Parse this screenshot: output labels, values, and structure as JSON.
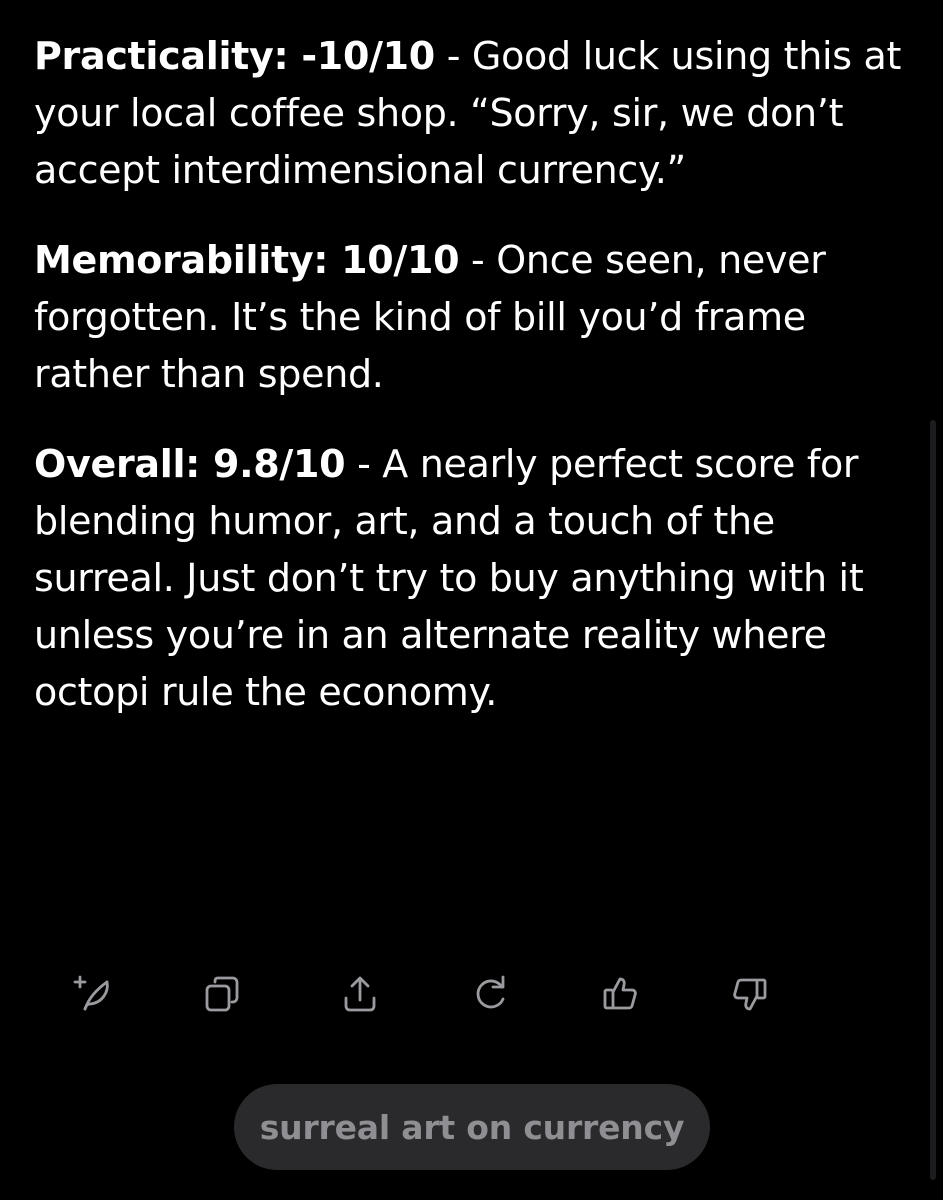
{
  "message": {
    "paragraphs": [
      {
        "label": "Practicality: -10/10",
        "text": " - Good luck using this at your local coffee shop. “Sorry, sir, we don’t accept interdimensional currency.”"
      },
      {
        "label": "Memorability: 10/10",
        "text": " - Once seen, never forgotten. It’s the kind of bill you’d frame rather than spend."
      },
      {
        "label": "Overall: 9.8/10",
        "text": " - A nearly perfect score for blending humor, art, and a touch of the surreal. Just don’t try to buy anything with it unless you’re in an alternate reality where octopi rule the economy."
      }
    ]
  },
  "actions": [
    {
      "icon": "edit-sparkle-icon"
    },
    {
      "icon": "copy-icon"
    },
    {
      "icon": "share-icon"
    },
    {
      "icon": "regenerate-icon"
    },
    {
      "icon": "thumbs-up-icon"
    },
    {
      "icon": "thumbs-down-icon"
    }
  ],
  "suggestion": {
    "label": "surreal art on currency"
  },
  "colors": {
    "background": "#000000",
    "text": "#ffffff",
    "icon": "#9b9b9f",
    "chip_background": "#2a2a2c",
    "chip_text": "#8e8e93"
  }
}
